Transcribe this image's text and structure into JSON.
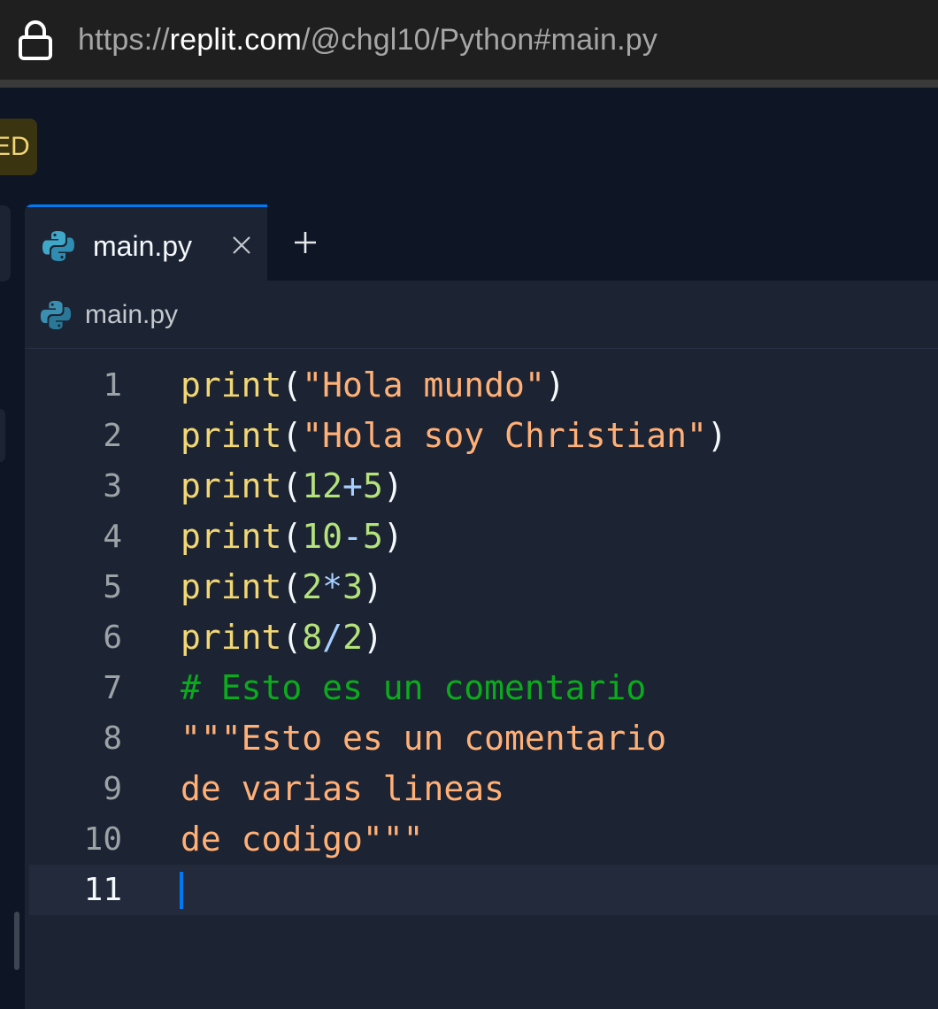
{
  "browser": {
    "url_prefix": "https://",
    "url_host": "replit.com",
    "url_path": "/@chgl10/Python#main.py"
  },
  "workspace": {
    "badge_text": "ED"
  },
  "editor": {
    "tab": {
      "label": "main.py"
    },
    "breadcrumb": {
      "label": "main.py"
    },
    "lines": [
      {
        "num": "1",
        "tokens": [
          {
            "t": "print",
            "c": "fn"
          },
          {
            "t": "(",
            "c": "pn"
          },
          {
            "t": "\"Hola mundo\"",
            "c": "str"
          },
          {
            "t": ")",
            "c": "pn"
          }
        ]
      },
      {
        "num": "2",
        "tokens": [
          {
            "t": "print",
            "c": "fn"
          },
          {
            "t": "(",
            "c": "pn"
          },
          {
            "t": "\"Hola soy Christian\"",
            "c": "str"
          },
          {
            "t": ")",
            "c": "pn"
          }
        ]
      },
      {
        "num": "3",
        "tokens": [
          {
            "t": "print",
            "c": "fn"
          },
          {
            "t": "(",
            "c": "pn"
          },
          {
            "t": "12",
            "c": "num"
          },
          {
            "t": "+",
            "c": "op"
          },
          {
            "t": "5",
            "c": "num"
          },
          {
            "t": ")",
            "c": "pn"
          }
        ]
      },
      {
        "num": "4",
        "tokens": [
          {
            "t": "print",
            "c": "fn"
          },
          {
            "t": "(",
            "c": "pn"
          },
          {
            "t": "10",
            "c": "num"
          },
          {
            "t": "-",
            "c": "op"
          },
          {
            "t": "5",
            "c": "num"
          },
          {
            "t": ")",
            "c": "pn"
          }
        ]
      },
      {
        "num": "5",
        "tokens": [
          {
            "t": "print",
            "c": "fn"
          },
          {
            "t": "(",
            "c": "pn"
          },
          {
            "t": "2",
            "c": "num"
          },
          {
            "t": "*",
            "c": "op"
          },
          {
            "t": "3",
            "c": "num"
          },
          {
            "t": ")",
            "c": "pn"
          }
        ]
      },
      {
        "num": "6",
        "tokens": [
          {
            "t": "print",
            "c": "fn"
          },
          {
            "t": "(",
            "c": "pn"
          },
          {
            "t": "8",
            "c": "num"
          },
          {
            "t": "/",
            "c": "op"
          },
          {
            "t": "2",
            "c": "num"
          },
          {
            "t": ")",
            "c": "pn"
          }
        ]
      },
      {
        "num": "7",
        "tokens": [
          {
            "t": "# Esto es un comentario",
            "c": "cm"
          }
        ]
      },
      {
        "num": "8",
        "tokens": [
          {
            "t": "\"\"\"Esto es un comentario",
            "c": "str"
          }
        ]
      },
      {
        "num": "9",
        "tokens": [
          {
            "t": "de varias lineas",
            "c": "str"
          }
        ]
      },
      {
        "num": "10",
        "tokens": [
          {
            "t": "de codigo\"\"\"",
            "c": "str"
          }
        ]
      },
      {
        "num": "11",
        "tokens": [],
        "active": true
      }
    ]
  },
  "colors": {
    "accent": "#0079f2",
    "function": "#f1d674",
    "string": "#ffb077",
    "number": "#b4e27b",
    "operator": "#a7d0ff",
    "comment": "#0bab1d"
  },
  "icons": {
    "lock": "lock-icon",
    "python": "python-icon",
    "close": "close-icon",
    "add": "plus-icon"
  }
}
